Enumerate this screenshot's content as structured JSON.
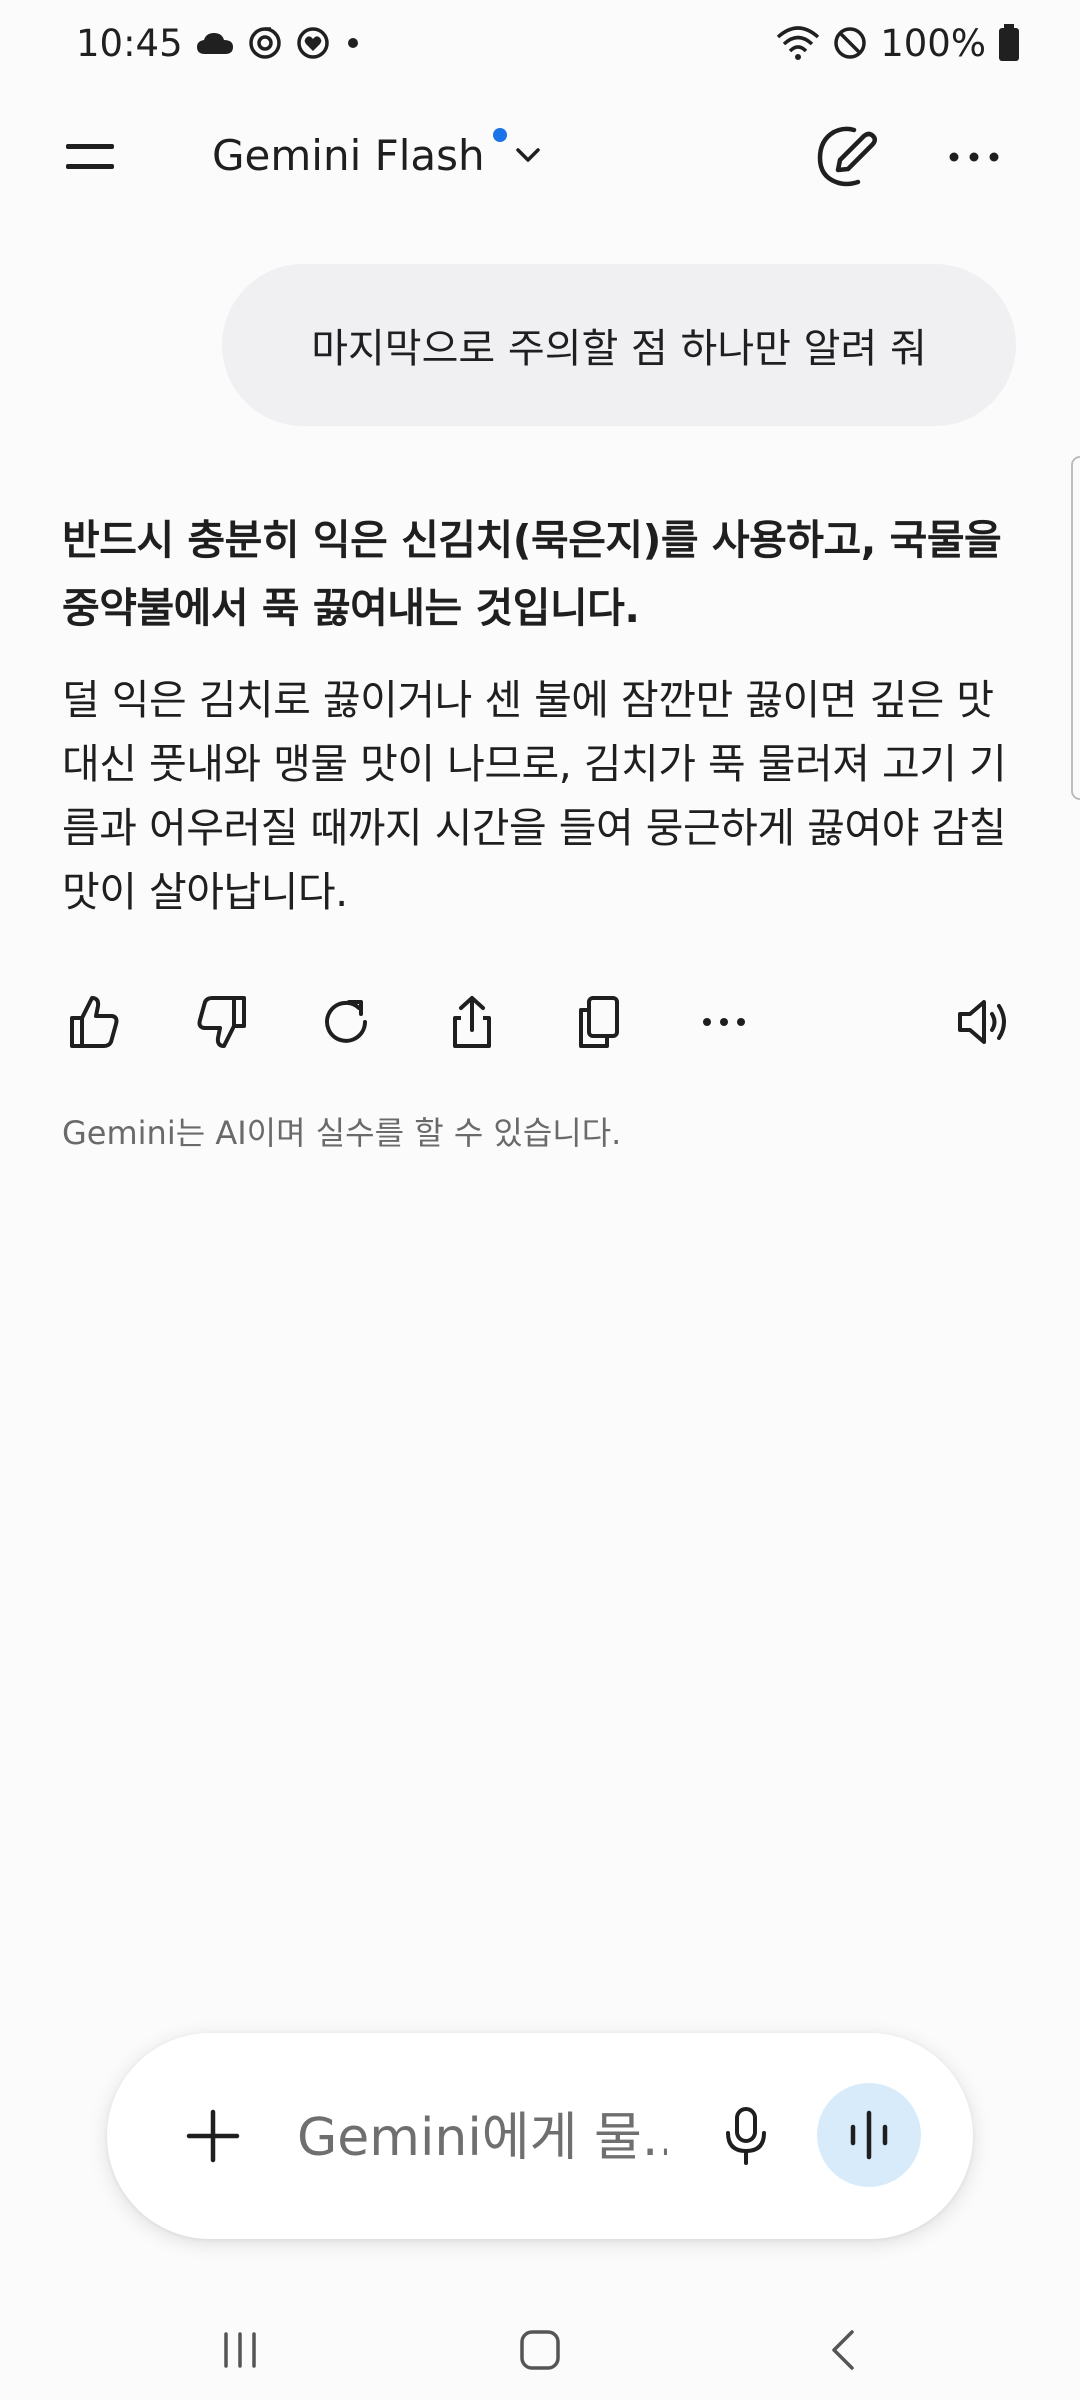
{
  "status_bar": {
    "time": "10:45",
    "battery": "100%",
    "icons": [
      "cloud-icon",
      "sync-icon",
      "heart-badge-icon",
      "dot-icon",
      "wifi-icon",
      "do-not-disturb-icon",
      "battery-icon"
    ]
  },
  "app_bar": {
    "model_name": "Gemini Flash",
    "icons": [
      "menu-icon",
      "chevron-down-icon",
      "new-chat-icon",
      "more-icon"
    ]
  },
  "conversation": {
    "user_message": "마지막으로 주의할 점 하나만 알려 줘",
    "response": {
      "paragraph_bold": "반드시 충분히 익은 신김치(묵은지)를 사용하고, 국물을 중약불에서 푹 끓여내는 것입니다.",
      "paragraph": "덜 익은 김치로 끓이거나 센 불에 잠깐만 끓이면 깊은 맛 대신 풋내와 맹물 맛이 나므로, 김치가 푹 물러져 고기 기름과 어우러질 때까지 시간을 들여 뭉근하게 끓여야 감칠맛이 살아납니다."
    },
    "actions": [
      "thumbs-up-icon",
      "thumbs-down-icon",
      "regenerate-icon",
      "share-icon",
      "copy-icon",
      "more-icon",
      "speaker-icon"
    ],
    "disclaimer": "Gemini는 AI이며 실수를 할 수 있습니다."
  },
  "input": {
    "placeholder": "Gemini에게 물...",
    "value": ""
  },
  "nav_bar": {
    "icons": [
      "recents-icon",
      "home-icon",
      "back-icon"
    ]
  },
  "colors": {
    "background": "#fcfbfc",
    "user_bubble": "#f0eff1",
    "accent_dot": "#1a73e8",
    "live_button": "#d7ebfb"
  }
}
